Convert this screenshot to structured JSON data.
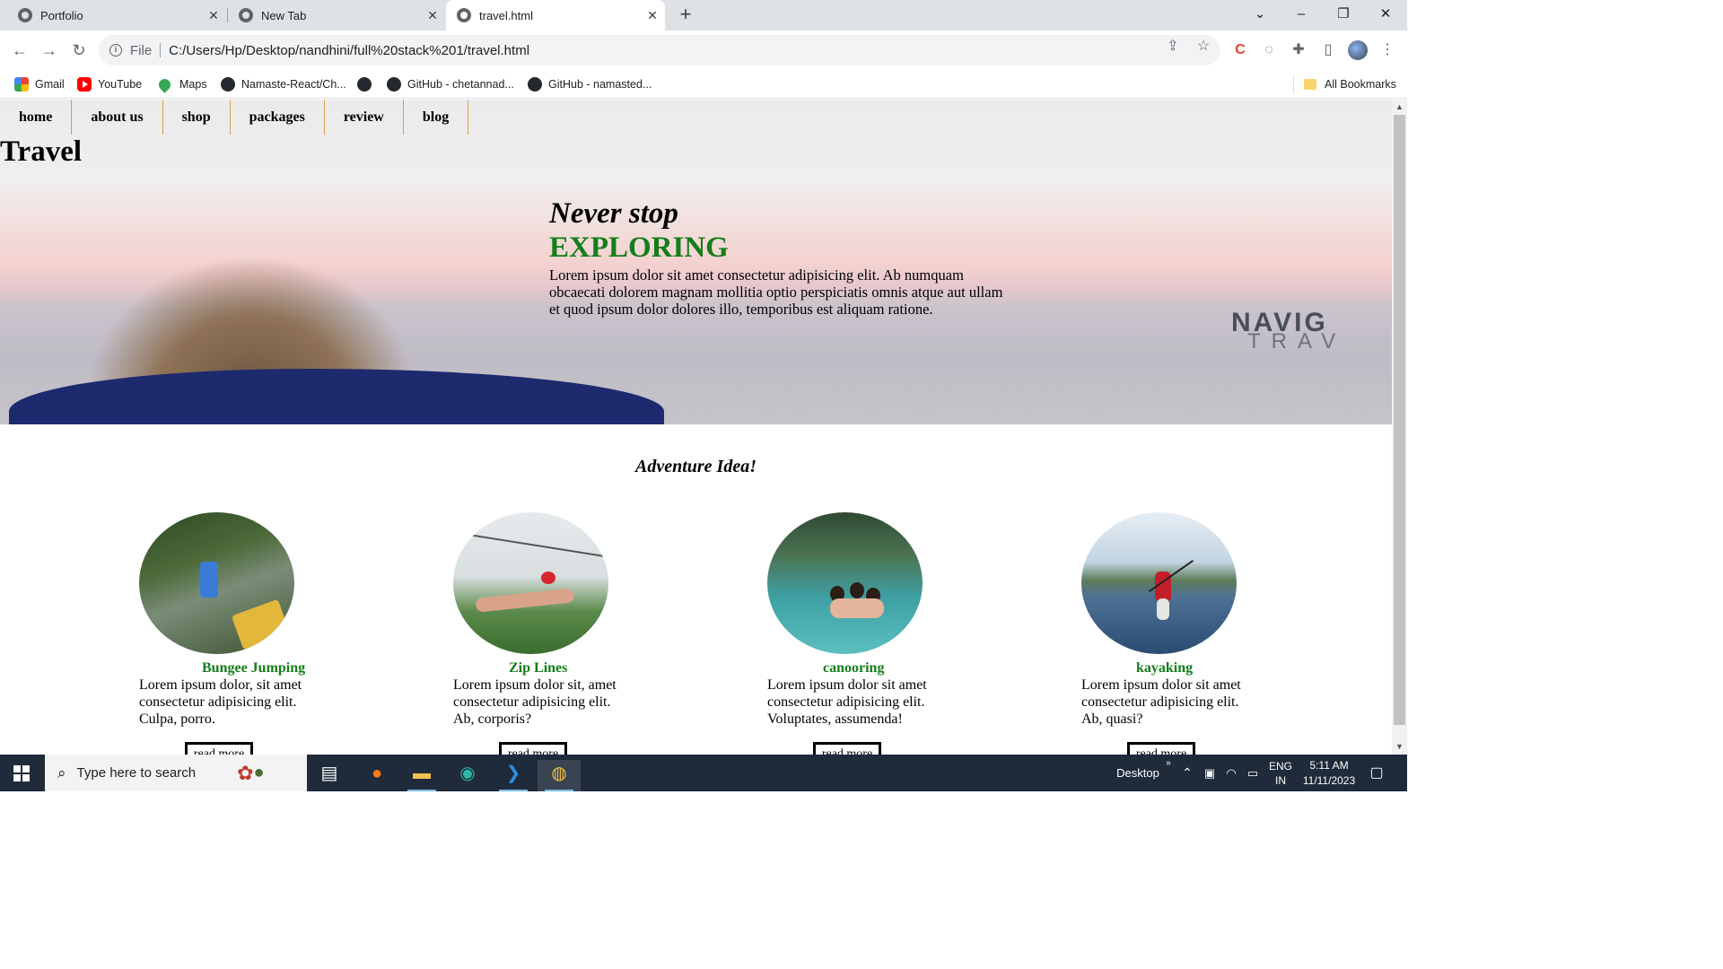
{
  "browser": {
    "tabs": [
      {
        "title": "Portfolio",
        "active": false
      },
      {
        "title": "New Tab",
        "active": false
      },
      {
        "title": "travel.html",
        "active": true
      }
    ],
    "address": {
      "scheme": "File",
      "url": "C:/Users/Hp/Desktop/nandhini/full%20stack%201/travel.html"
    },
    "bookmarks": [
      {
        "label": "Gmail",
        "icon": "gmail-icon"
      },
      {
        "label": "YouTube",
        "icon": "youtube-icon"
      },
      {
        "label": "Maps",
        "icon": "maps-icon"
      },
      {
        "label": "Namaste-React/Ch...",
        "icon": "github-icon"
      },
      {
        "label": "",
        "icon": "github-icon"
      },
      {
        "label": "GitHub - chetannad...",
        "icon": "github-icon"
      },
      {
        "label": "GitHub - namasted...",
        "icon": "github-icon"
      }
    ],
    "all_bookmarks": "All Bookmarks"
  },
  "page": {
    "nav": [
      "home",
      "about us",
      "shop",
      "packages",
      "review",
      "blog"
    ],
    "brand": "Travel",
    "hero": {
      "line1": "Never stop",
      "line2": "EXPLORING",
      "text": "Lorem ipsum dolor sit amet consectetur adipisicing elit. Ab numquam obcaecati dolorem magnam mollitia optio perspiciatis omnis atque aut ullam et quod ipsum dolor dolores illo, temporibus est aliquam ratione."
    },
    "section_title": "Adventure Idea!",
    "cards": [
      {
        "title": "Bungee Jumping",
        "text": "Lorem ipsum dolor, sit amet consectetur adipisicing elit. Culpa, porro.",
        "button": "read more"
      },
      {
        "title": "Zip Lines",
        "text": "Lorem ipsum dolor sit, amet consectetur adipisicing elit. Ab, corporis?",
        "button": "read more"
      },
      {
        "title": "canooring",
        "text": "Lorem ipsum dolor sit amet consectetur adipisicing elit. Voluptates, assumenda!",
        "button": "read more"
      },
      {
        "title": "kayaking",
        "text": "Lorem ipsum dolor sit amet consectetur adipisicing elit. Ab, quasi?",
        "button": "read more"
      }
    ]
  },
  "taskbar": {
    "search_placeholder": "Type here to search",
    "desktop_label": "Desktop",
    "lang": "ENG",
    "region": "IN",
    "time": "5:11 AM",
    "date": "11/11/2023"
  },
  "colors": {
    "accent_green": "#137e1a",
    "nav_divider": "#d4a24a",
    "taskbar": "#1f2a3a"
  }
}
